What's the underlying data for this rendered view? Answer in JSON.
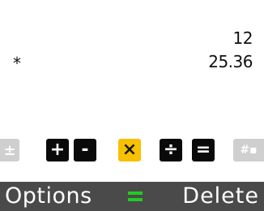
{
  "display": {
    "first_operand": "12",
    "operator_symbol": "*",
    "second_operand": "25.36"
  },
  "keypad": {
    "left_key": "±",
    "operators": [
      {
        "id": "add",
        "label": "+",
        "active": false
      },
      {
        "id": "subtract",
        "label": "-",
        "active": false
      },
      {
        "id": "multiply",
        "label": "×",
        "active": true
      },
      {
        "id": "divide",
        "label": "÷",
        "active": false
      },
      {
        "id": "equals",
        "label": "=",
        "active": false
      }
    ],
    "right_key": "#▪"
  },
  "softkeys": {
    "left": "Options",
    "center_icon": "menu-lines-icon",
    "right": "Delete"
  },
  "colors": {
    "active_key": "#f6c100",
    "key": "#0a0a0a",
    "softbar": "#4a4a4a",
    "center_icon": "#22cc22"
  }
}
